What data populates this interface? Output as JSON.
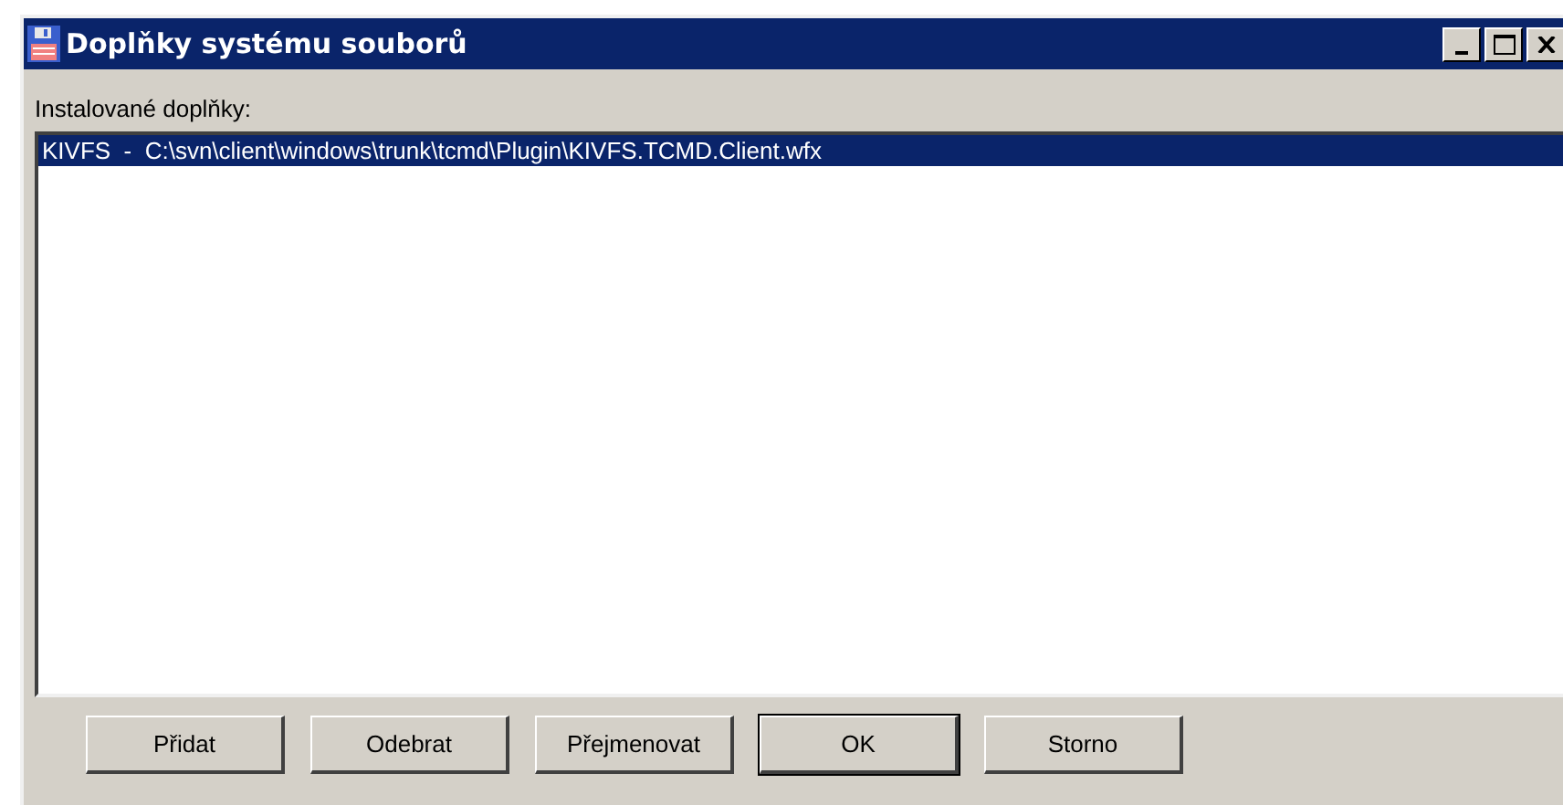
{
  "window": {
    "title": "Doplňky systému souborů"
  },
  "list_label": "Instalované doplňky:",
  "plugins": [
    {
      "text": "KIVFS  -  C:\\svn\\client\\windows\\trunk\\tcmd\\Plugin\\KIVFS.TCMD.Client.wfx",
      "selected": true
    }
  ],
  "buttons": [
    {
      "label": "Přidat",
      "default": false
    },
    {
      "label": "Odebrat",
      "default": false
    },
    {
      "label": "Přejmenovat",
      "default": false
    },
    {
      "label": "OK",
      "default": true
    },
    {
      "label": "Storno",
      "default": false
    }
  ]
}
